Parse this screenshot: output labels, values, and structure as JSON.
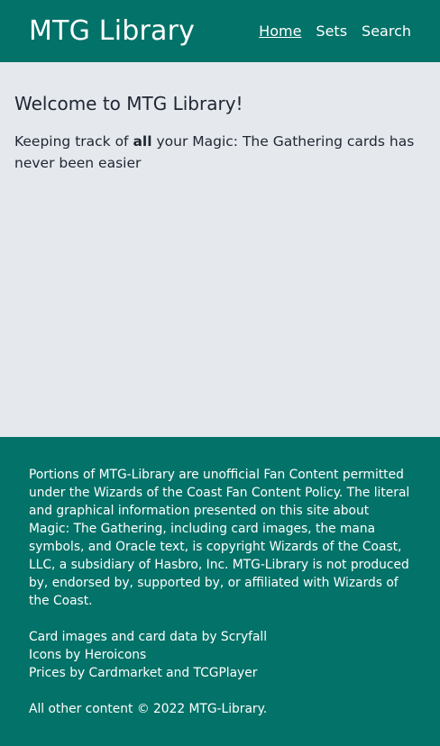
{
  "header": {
    "title": "MTG Library",
    "nav": [
      {
        "label": "Home",
        "active": true
      },
      {
        "label": "Sets",
        "active": false
      },
      {
        "label": "Search",
        "active": false
      }
    ]
  },
  "main": {
    "heading": "Welcome to MTG Library!",
    "intro_before": "Keeping track of ",
    "intro_bold": "all",
    "intro_after_line1": " your Magic: The Gathering cards has",
    "intro_line2": "never been easier"
  },
  "footer": {
    "disclaimer_lines": [
      "Portions of MTG-Library are unofficial Fan Content permitted",
      "under the Wizards of the Coast Fan Content Policy. The literal",
      "and graphical information presented on this site about",
      "Magic: The Gathering, including card images, the mana",
      "symbols, and Oracle text, is copyright Wizards of the Coast,",
      "LLC, a subsidiary of Hasbro, Inc. MTG-Library is not produced",
      "by, endorsed by, supported by, or affiliated with Wizards of",
      "the Coast."
    ],
    "credits": [
      "Card images and card data by Scryfall",
      "Icons by Heroicons",
      "Prices by Cardmarket and TCGPlayer"
    ],
    "copyright": "All other content © 2022 MTG-Library."
  },
  "colors": {
    "brand": "#037268",
    "background": "#e5e8ed",
    "text": "#1f2733"
  }
}
